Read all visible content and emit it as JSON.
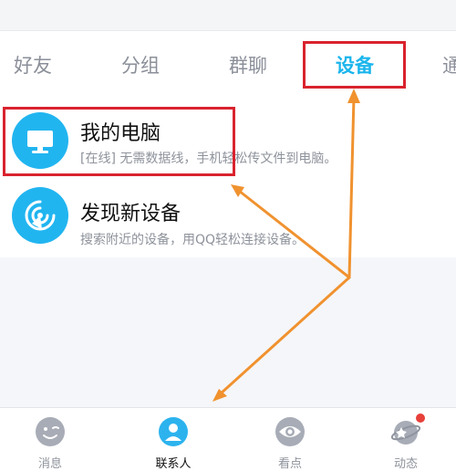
{
  "tabs": [
    {
      "label": "好友",
      "active": false
    },
    {
      "label": "分组",
      "active": false
    },
    {
      "label": "群聊",
      "active": false
    },
    {
      "label": "设备",
      "active": true
    },
    {
      "label": "通",
      "active": false
    }
  ],
  "devices": [
    {
      "title": "我的电脑",
      "subtitle": "[在线] 无需数据线，手机轻松传文件到电脑。",
      "icon": "computer-icon"
    },
    {
      "title": "发现新设备",
      "subtitle": "搜索附近的设备，用QQ轻松连接设备。",
      "icon": "radar-icon"
    }
  ],
  "bottom_nav": [
    {
      "label": "消息",
      "icon": "message-icon",
      "active": false
    },
    {
      "label": "联系人",
      "icon": "contacts-icon",
      "active": true
    },
    {
      "label": "看点",
      "icon": "eye-icon",
      "active": false
    },
    {
      "label": "动态",
      "icon": "planet-icon",
      "active": false
    }
  ],
  "colors": {
    "accent": "#1ab5ec",
    "highlight": "#d9232e",
    "arrow": "#f0922f",
    "badge": "#e8403a"
  }
}
